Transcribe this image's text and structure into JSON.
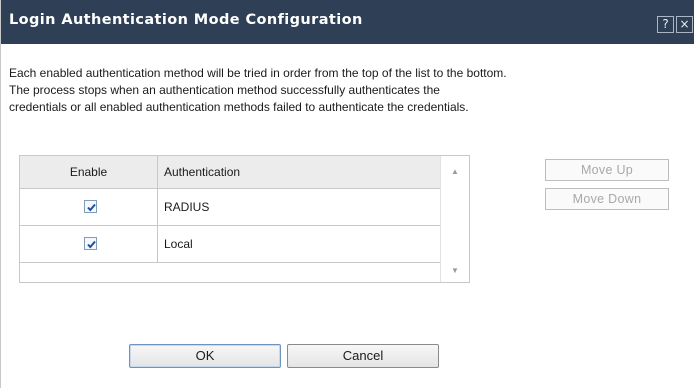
{
  "dialog": {
    "title": "Login Authentication Mode Configuration",
    "help_glyph": "?",
    "close_glyph": "×"
  },
  "description": {
    "line1": "Each enabled authentication method will be tried in order from the top of the list to the bottom.",
    "line2": "The process stops when an authentication method successfully authenticates the",
    "line3": "credentials or all enabled authentication methods failed to authenticate the credentials."
  },
  "table": {
    "columns": [
      "Enable",
      "Authentication"
    ],
    "rows": [
      {
        "enabled": true,
        "method": "RADIUS"
      },
      {
        "enabled": true,
        "method": "Local"
      }
    ]
  },
  "buttons": {
    "move_up": "Move Up",
    "move_down": "Move Down",
    "ok": "OK",
    "cancel": "Cancel"
  },
  "icons": {
    "help": "help-icon",
    "close": "close-icon",
    "check": "checkmark-icon",
    "scroll_up": "scroll-up-arrow-icon",
    "scroll_down": "scroll-down-arrow-icon"
  },
  "colors": {
    "titlebar": "#2e3f56",
    "checkmark": "#1f4f9e",
    "disabled_text": "#a8a8a8"
  }
}
